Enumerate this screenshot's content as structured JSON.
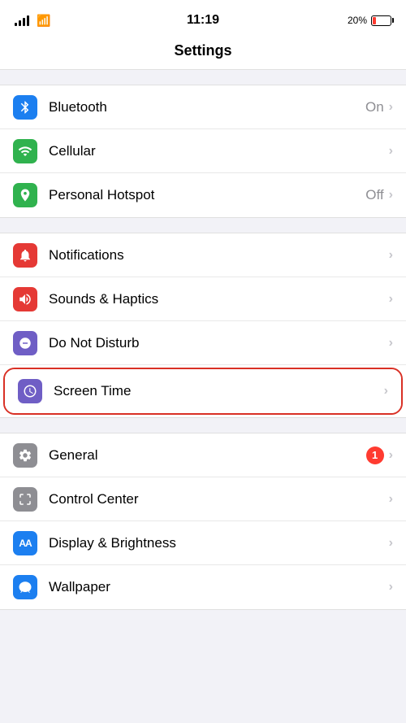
{
  "statusBar": {
    "time": "11:19",
    "batteryPercent": "20%",
    "batteryFill": 20
  },
  "pageTitle": "Settings",
  "groups": [
    {
      "id": "connectivity",
      "items": [
        {
          "id": "bluetooth",
          "label": "Bluetooth",
          "icon": "bluetooth",
          "iconSymbol": "✦",
          "value": "On",
          "chevron": true
        },
        {
          "id": "cellular",
          "label": "Cellular",
          "icon": "cellular",
          "iconSymbol": "((·))",
          "value": "",
          "chevron": true
        },
        {
          "id": "hotspot",
          "label": "Personal Hotspot",
          "icon": "hotspot",
          "iconSymbol": "⛓",
          "value": "Off",
          "chevron": true
        }
      ]
    },
    {
      "id": "notifications",
      "items": [
        {
          "id": "notifications",
          "label": "Notifications",
          "icon": "notifications",
          "iconSymbol": "🔔",
          "value": "",
          "chevron": true
        },
        {
          "id": "sounds",
          "label": "Sounds & Haptics",
          "icon": "sounds",
          "iconSymbol": "🔊",
          "value": "",
          "chevron": true
        },
        {
          "id": "donotdisturb",
          "label": "Do Not Disturb",
          "icon": "donotdisturb",
          "iconSymbol": "🌙",
          "value": "",
          "chevron": true
        },
        {
          "id": "screentime",
          "label": "Screen Time",
          "icon": "screentime",
          "iconSymbol": "⌛",
          "value": "",
          "chevron": true,
          "highlighted": true
        }
      ]
    },
    {
      "id": "general",
      "items": [
        {
          "id": "general",
          "label": "General",
          "icon": "general",
          "iconSymbol": "⚙",
          "value": "",
          "badge": "1",
          "chevron": true
        },
        {
          "id": "controlcenter",
          "label": "Control Center",
          "icon": "controlcenter",
          "iconSymbol": "⊟",
          "value": "",
          "chevron": true
        },
        {
          "id": "display",
          "label": "Display & Brightness",
          "icon": "display",
          "iconSymbol": "AA",
          "value": "",
          "chevron": true
        },
        {
          "id": "wallpaper",
          "label": "Wallpaper",
          "icon": "wallpaper",
          "iconSymbol": "✿",
          "value": "",
          "chevron": true
        }
      ]
    }
  ]
}
